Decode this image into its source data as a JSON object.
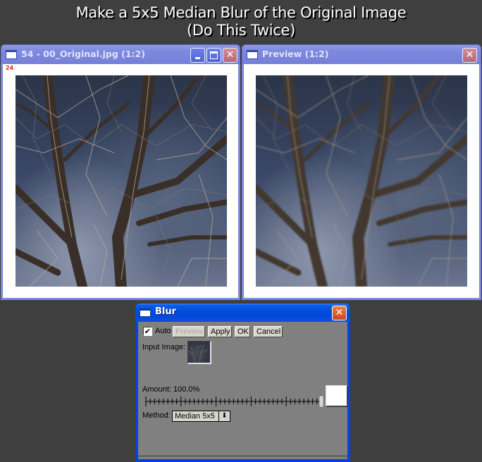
{
  "headline": {
    "line1": "Make a 5x5 Median Blur of the Original Image",
    "line2": "(Do This Twice)"
  },
  "original_window": {
    "title": "54 - 00_Original.jpg (1:2)",
    "zoom_label": "24",
    "buttons": [
      "minimize",
      "maximize",
      "close"
    ],
    "image_description": "Bare tree branches against a dusky blue sky"
  },
  "preview_window": {
    "title": "Preview (1:2)",
    "buttons": [
      "close"
    ],
    "image_description": "Blurred version of bare tree branches against a dusky blue sky"
  },
  "blur_dialog": {
    "title": "Blur",
    "auto_label": "Auto",
    "auto_checked": true,
    "check_glyph": "✔",
    "preview_label": "Preview",
    "apply_label": "Apply",
    "ok_label": "OK",
    "cancel_label": "Cancel",
    "input_image_label": "Input Image:",
    "amount_label": "Amount: 100.0%",
    "amount_value_percent": 100.0,
    "method_label": "Method:",
    "method_value": "Median 5x5",
    "dropdown_arrow_glyph": "⬇",
    "close_glyph": "✕"
  },
  "icons": {
    "close": "✕",
    "minimize": "minimize-bar",
    "maximize": "maximize-box"
  },
  "colors": {
    "desktop_bg": "#3f3f3f",
    "inactive_titlebar": "#7e8ade",
    "active_titlebar": "#0048d8",
    "dialog_body": "#808080",
    "zoom_label": "#e8241c"
  }
}
